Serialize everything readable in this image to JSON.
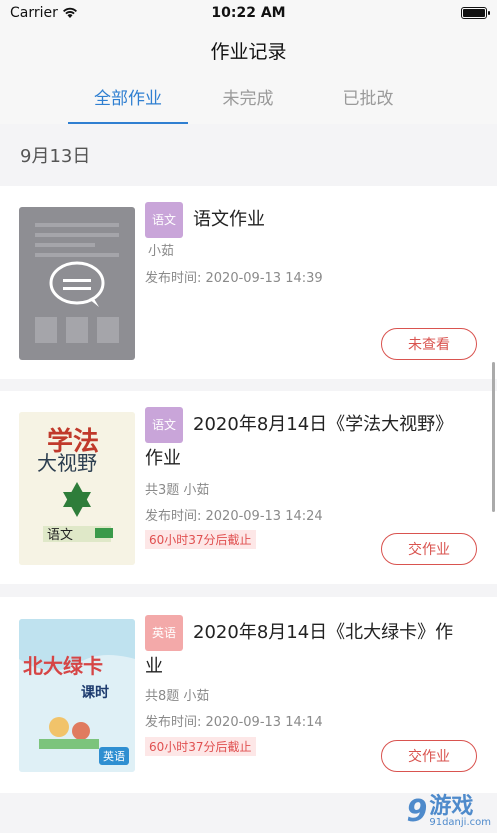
{
  "status": {
    "carrier": "Carrier",
    "time": "10:22 AM"
  },
  "nav": {
    "title": "作业记录"
  },
  "tabs": [
    {
      "label": "全部作业",
      "active": true
    },
    {
      "label": "未完成",
      "active": false
    },
    {
      "label": "已批改",
      "active": false
    }
  ],
  "date_header": "9月13日",
  "cards": [
    {
      "tag": "语文",
      "title": "语文作业",
      "info": "小茹",
      "published": "发布时间: 2020-09-13 14:39",
      "deadline": "",
      "button": "未查看"
    },
    {
      "tag": "语文",
      "title": "2020年8月14日《学法大视野》作业",
      "info": "共3题 小茹",
      "published": "发布时间: 2020-09-13 14:24",
      "deadline": "60小时37分后截止",
      "button": "交作业"
    },
    {
      "tag": "英语",
      "title": "2020年8月14日《北大绿卡》作业",
      "info": "共8题 小茹",
      "published": "发布时间: 2020-09-13 14:14",
      "deadline": "60小时37分后截止",
      "button": "交作业"
    }
  ],
  "covers": {
    "book1_title": "学法",
    "book1_sub": "大视野",
    "book1_subject": "语文",
    "book2_title": "北大绿卡",
    "book2_sub": "课时",
    "book2_subject": "英语"
  },
  "watermark": {
    "num": "9",
    "main": "游戏",
    "sub": "91danji.com"
  },
  "colors": {
    "accent": "#2f7fd1",
    "action": "#d9534f",
    "deadline": "#e05050"
  }
}
